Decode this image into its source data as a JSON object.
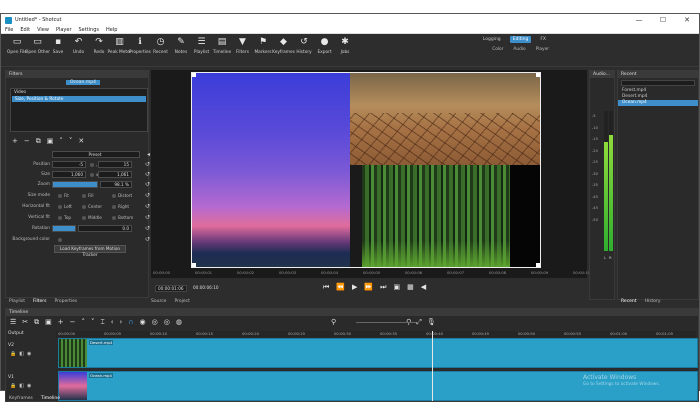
{
  "window": {
    "title": "Untitled* - Shotcut",
    "min": "—",
    "max": "☐",
    "close": "✕"
  },
  "menu": [
    "File",
    "Edit",
    "View",
    "Player",
    "Settings",
    "Help"
  ],
  "toolbar": [
    {
      "label": "Open File",
      "icon": "folder-open-icon",
      "glyph": "▭"
    },
    {
      "label": "Open Other",
      "icon": "folder-icon",
      "glyph": "▭"
    },
    {
      "label": "Save",
      "icon": "save-icon",
      "glyph": "▪"
    },
    {
      "label": "Undo",
      "icon": "undo-icon",
      "glyph": "↶"
    },
    {
      "label": "Redo",
      "icon": "redo-icon",
      "glyph": "↷"
    },
    {
      "label": "Peak Meter",
      "icon": "peak-meter-icon",
      "glyph": "▥"
    },
    {
      "label": "Properties",
      "icon": "info-icon",
      "glyph": "ℹ"
    },
    {
      "label": "Recent",
      "icon": "clock-icon",
      "glyph": "◷"
    },
    {
      "label": "Notes",
      "icon": "notes-icon",
      "glyph": "✎"
    },
    {
      "label": "Playlist",
      "icon": "playlist-icon",
      "glyph": "☰"
    },
    {
      "label": "Timeline",
      "icon": "timeline-icon",
      "glyph": "▤"
    },
    {
      "label": "Filters",
      "icon": "filter-icon",
      "glyph": "▼"
    },
    {
      "label": "Markers",
      "icon": "marker-icon",
      "glyph": "⚑"
    },
    {
      "label": "Keyframes",
      "icon": "keyframes-icon",
      "glyph": "◆"
    },
    {
      "label": "History",
      "icon": "history-icon",
      "glyph": "↺"
    },
    {
      "label": "Export",
      "icon": "export-icon",
      "glyph": "●"
    },
    {
      "label": "Jobs",
      "icon": "gear-icon",
      "glyph": "✱"
    }
  ],
  "layouts": {
    "top": [
      "Logging",
      "Editing",
      "FX"
    ],
    "active": "Editing",
    "sub": [
      "Color",
      "Audio",
      "Player"
    ]
  },
  "filters": {
    "title": "Filters",
    "source": "Ocean.mp4",
    "group": "Video",
    "selected": "Size, Position & Rotate",
    "preset": "Preset",
    "position_label": "Position",
    "position": [
      "-5",
      "15"
    ],
    "size_label": "Size",
    "size": [
      "1,060",
      "1,061"
    ],
    "zoom_label": "Zoom",
    "zoom": "98.1 %",
    "size_mode_label": "Size mode",
    "size_modes": [
      "Fit",
      "Fill",
      "Distort"
    ],
    "horizontal_label": "Horizontal fit",
    "horizontal": [
      "Left",
      "Center",
      "Right"
    ],
    "vertical_label": "Vertical fit",
    "vertical": [
      "Top",
      "Middle",
      "Bottom"
    ],
    "rotation_label": "Rotation",
    "rotation": "0.0",
    "bgcolor_label": "Background color",
    "motion_button": "Load Keyframes from Motion Tracker"
  },
  "panel_tabs": [
    "Playlist",
    "Filters",
    "Properties"
  ],
  "viewer": {
    "ruler": [
      "00:00:00",
      "00:00:01",
      "00:00:02",
      "00:00:03",
      "00:00:04",
      "00:00:05",
      "00:00:06",
      "00:00:07",
      "00:00:08",
      "00:00:09",
      "00:00:10"
    ],
    "current_time": "00:00:01:06",
    "total_time": "00:00:06:10",
    "tabs": [
      "Source",
      "Project"
    ]
  },
  "audio": {
    "title": "Audio...",
    "db": [
      "-5",
      "-10",
      "-15",
      "-20",
      "-25",
      "-30",
      "-35",
      "-40",
      "-45",
      "-50"
    ],
    "lr": [
      "L",
      "R"
    ],
    "levels": [
      0.78,
      0.83
    ]
  },
  "recent": {
    "title": "Recent",
    "items": [
      "Forest.mp4",
      "Desert.mp4",
      "Ocean.mp4"
    ],
    "selected": 2,
    "tabs": [
      "Recent",
      "History"
    ]
  },
  "timeline": {
    "title": "Timeline",
    "output": "Output",
    "tracks": [
      "V2",
      "V1"
    ],
    "ruler": [
      "00:00:00",
      "00:00:05",
      "00:00:10",
      "00:00:15",
      "00:00:20",
      "00:00:25",
      "00:00:30",
      "00:00:35",
      "00:00:40",
      "00:00:45",
      "00:00:50",
      "00:00:55",
      "00:01:00",
      "00:01:05"
    ],
    "clips": [
      {
        "name": "Desert.mp4"
      },
      {
        "name": "Ocean.mp4"
      }
    ],
    "tabs": [
      "Keyframes",
      "Timeline"
    ]
  },
  "watermark": {
    "line1": "Activate Windows",
    "line2": "Go to Settings to activate Windows."
  }
}
